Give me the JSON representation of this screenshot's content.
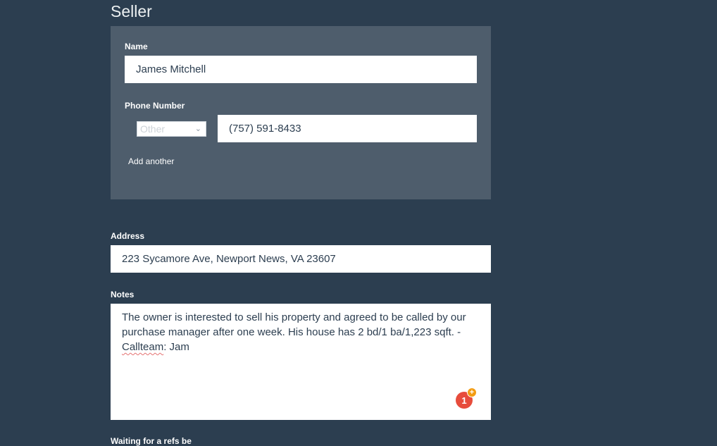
{
  "section_title": "Seller",
  "seller": {
    "name_label": "Name",
    "name_value": "James Mitchell",
    "phone_label": "Phone Number",
    "phone_type_selected": "Other",
    "phone_value": "(757) 591-8433",
    "add_another": "Add another"
  },
  "address": {
    "label": "Address",
    "value": "223 Sycamore Ave, Newport News, VA 23607"
  },
  "notes": {
    "label": "Notes",
    "text_before": "The owner is interested to sell his property and agreed to be called by our purchase manager after one week. His house has 2 bd/1 ba/1,223 sqft. -",
    "misspelled": "Callteam",
    "text_after": ": Jam"
  },
  "badge": {
    "count": "1",
    "plus": "+",
    "color": "#e74c3c",
    "plus_color": "#f39c12"
  },
  "next_section_partial": "Waiting for a refs be"
}
